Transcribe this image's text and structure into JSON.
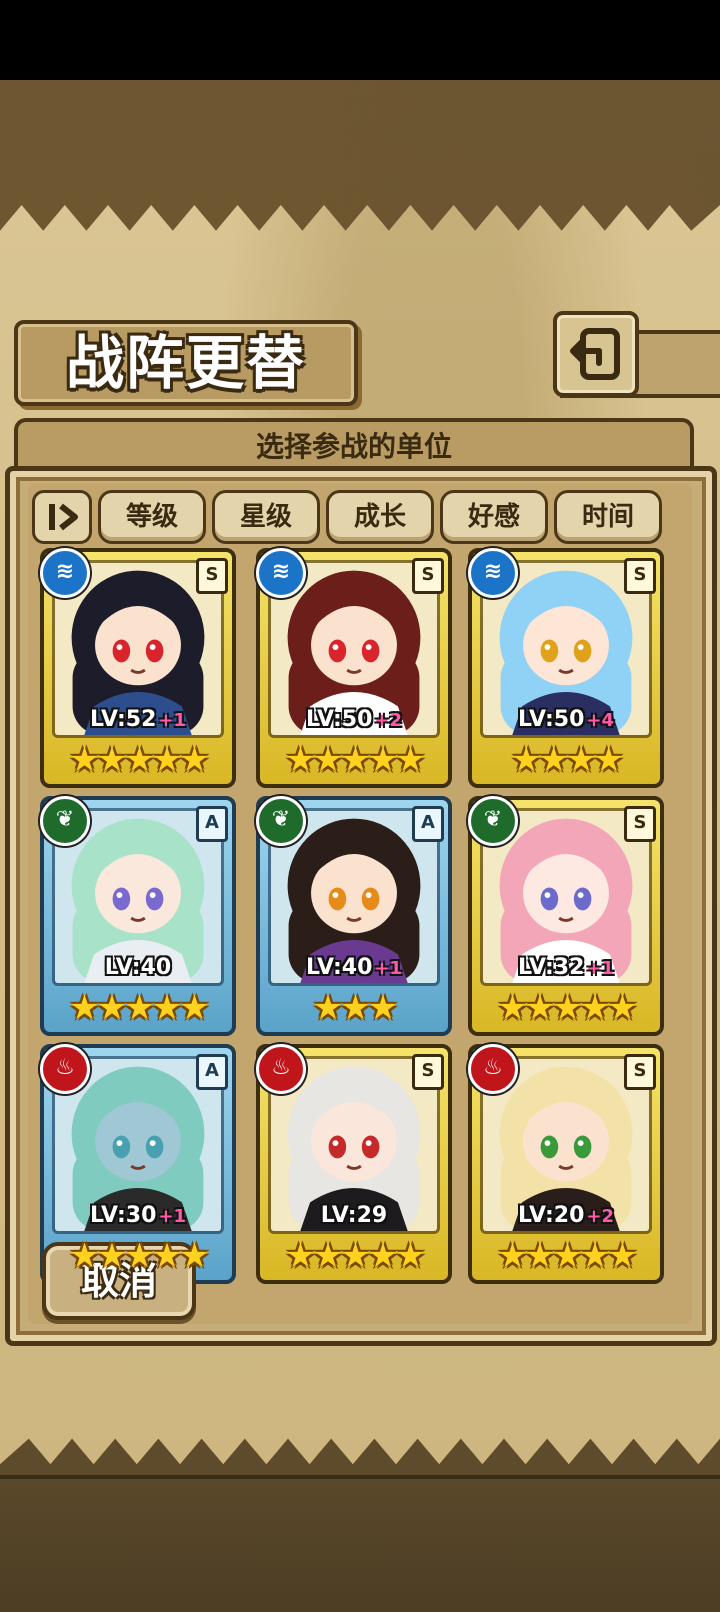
{
  "header": {
    "title": "战阵更替"
  },
  "panel": {
    "subtitle": "选择参战的单位"
  },
  "sort": {
    "buttons": [
      "等级",
      "星级",
      "成长",
      "好感",
      "时间"
    ]
  },
  "units": [
    {
      "element": "water",
      "rank": "S",
      "level": "LV:52",
      "bonus": "+1",
      "stars": "★★★★★",
      "frame": "gold",
      "hair": "#1c1c2a",
      "skin": "#fbe2cf",
      "eyes": "#d9242c",
      "outfit": "#2c4e8c"
    },
    {
      "element": "water",
      "rank": "S",
      "level": "LV:50",
      "bonus": "+2",
      "stars": "★★★★★",
      "frame": "gold",
      "hair": "#6b1e1a",
      "skin": "#fbe2cf",
      "eyes": "#d9242c",
      "outfit": "#ffffff"
    },
    {
      "element": "water",
      "rank": "S",
      "level": "LV:50",
      "bonus": "+4",
      "stars": "★★★★",
      "frame": "gold",
      "hair": "#8fd2f5",
      "skin": "#fde6d6",
      "eyes": "#e0a21a",
      "outfit": "#2a2e60"
    },
    {
      "element": "wood",
      "rank": "A",
      "level": "LV:40",
      "bonus": "",
      "stars": "★★★★★",
      "frame": "blue",
      "hair": "#a8e2c8",
      "skin": "#fbe8dc",
      "eyes": "#7a6ad0",
      "outfit": "#e9eef2"
    },
    {
      "element": "wood",
      "rank": "A",
      "level": "LV:40",
      "bonus": "+1",
      "stars": "★★★",
      "frame": "blue",
      "hair": "#2b1e18",
      "skin": "#fbe2cf",
      "eyes": "#e68a1a",
      "outfit": "#6a3a90"
    },
    {
      "element": "wood",
      "rank": "S",
      "level": "LV:32",
      "bonus": "+1",
      "stars": "★★★★★",
      "frame": "gold",
      "hair": "#f2a6b8",
      "skin": "#fde9e2",
      "eyes": "#6c6acb",
      "outfit": "#ffffff"
    },
    {
      "element": "fire",
      "rank": "A",
      "level": "LV:30",
      "bonus": "+1",
      "stars": "★★★★★",
      "frame": "blue",
      "hair": "#7fcbc0",
      "skin": "#9fc7d4",
      "eyes": "#49a0b0",
      "outfit": "#2a2a2a"
    },
    {
      "element": "fire",
      "rank": "S",
      "level": "LV:29",
      "bonus": "",
      "stars": "★★★★★",
      "frame": "gold",
      "hair": "#e8e6e2",
      "skin": "#fbe6dc",
      "eyes": "#c42a2a",
      "outfit": "#1e1b1e"
    },
    {
      "element": "fire",
      "rank": "S",
      "level": "LV:20",
      "bonus": "+2",
      "stars": "★★★★★",
      "frame": "gold",
      "hair": "#f3e2a8",
      "skin": "#fbe2cf",
      "eyes": "#3a9a3a",
      "outfit": "#2a1e1a"
    }
  ],
  "icons": {
    "back": "back-arrow-icon",
    "sort_toggle": "sort-order-icon",
    "water": "water-element-icon",
    "wood": "leaf-element-icon",
    "fire": "fire-element-icon"
  },
  "footer": {
    "cancel_label": "取消"
  }
}
